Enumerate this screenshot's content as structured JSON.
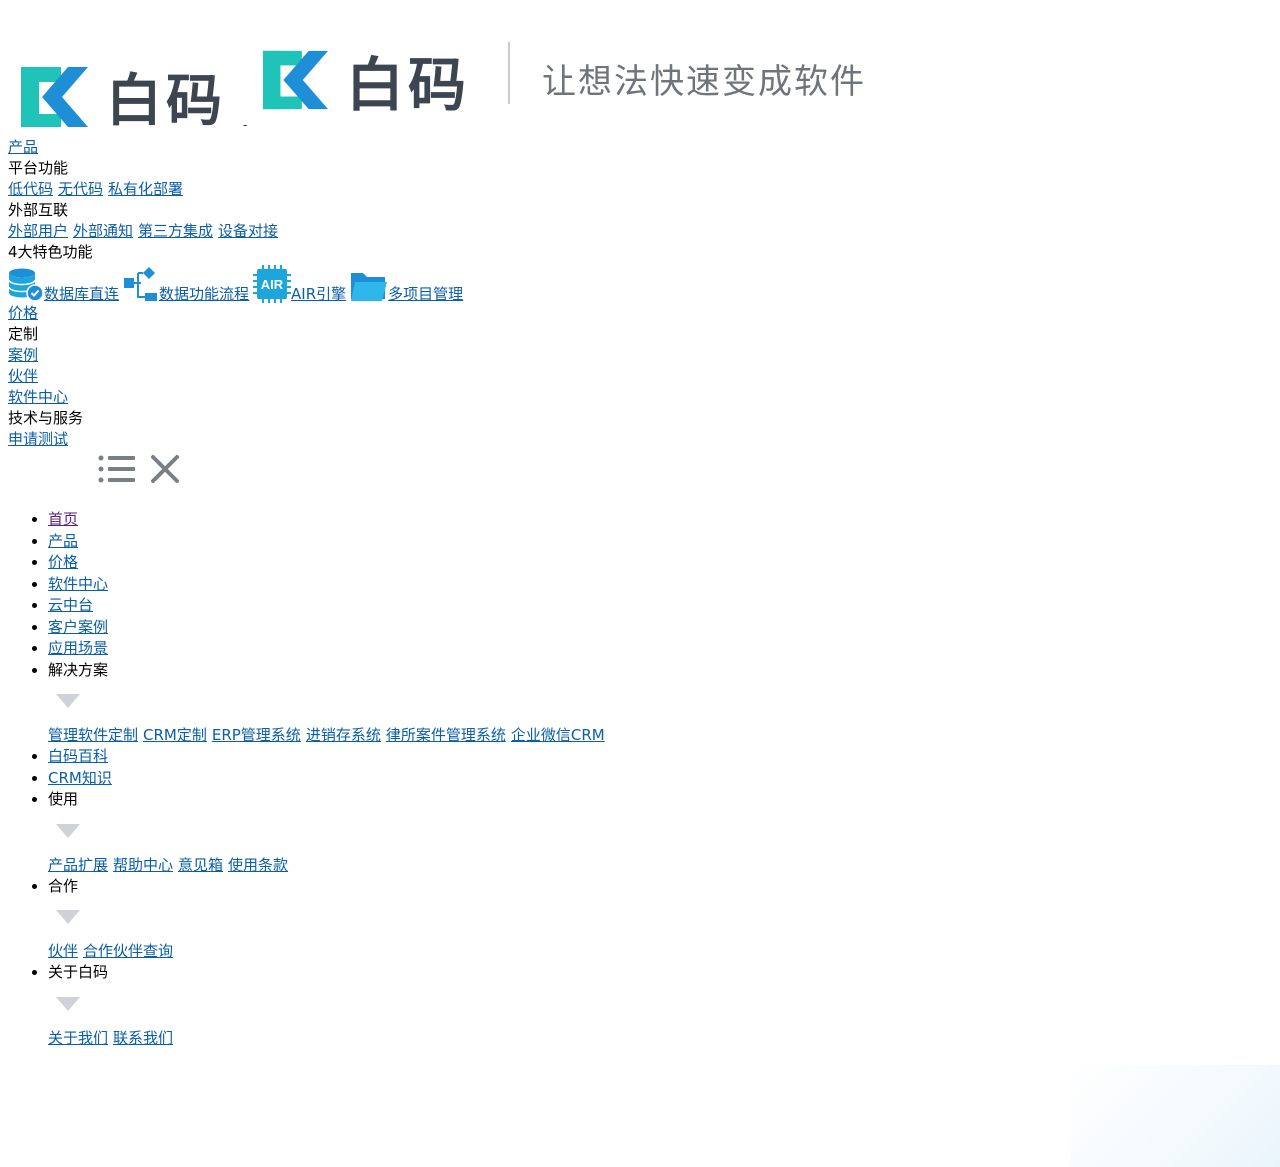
{
  "brand": {
    "logo_text": "白码",
    "slogan": "让想法快速变成软件",
    "colors": {
      "mark_blue": "#1e8fd6",
      "mark_teal": "#1fc3b7",
      "text_gray": "#3d4550",
      "link": "#0b5ea8",
      "visited": "#5a1f86"
    }
  },
  "top_nav": {
    "product_label": "产品",
    "platform_title": "平台功能",
    "platform_links": [
      "低代码",
      "无代码",
      "私有化部署"
    ],
    "external_title": "外部互联",
    "external_links": [
      "外部用户",
      "外部通知",
      "第三方集成",
      "设备对接"
    ],
    "features_title": "4大特色功能",
    "features": [
      {
        "label": "数据库直连",
        "icon": "database-icon"
      },
      {
        "label": "数据功能流程",
        "icon": "flow-icon"
      },
      {
        "label": "AIR引擎",
        "icon": "air-chip-icon",
        "badge": "AIR"
      },
      {
        "label": "多项目管理",
        "icon": "folder-icon"
      }
    ],
    "price": "价格",
    "custom_title": "定制",
    "cases": "案例",
    "partner": "伙伴",
    "software_center": "软件中心",
    "tech_title": "技术与服务",
    "apply_trial": "申请测试"
  },
  "toggle": {
    "menu_icon": "list-icon",
    "close_icon": "close-icon"
  },
  "main_menu": {
    "home": "首页",
    "product": "产品",
    "price": "价格",
    "software_center": "软件中心",
    "cloud": "云中台",
    "customer_cases": "客户案例",
    "scenarios": "应用场景",
    "solutions": {
      "title": "解决方案",
      "links": [
        "管理软件定制",
        "CRM定制",
        "ERP管理系统",
        "进销存系统",
        "律所案件管理系统",
        "企业微信CRM"
      ]
    },
    "wiki": "白码百科",
    "crm_knowledge": "CRM知识",
    "usage": {
      "title": "使用",
      "links": [
        "产品扩展",
        "帮助中心",
        "意见箱",
        "使用条款"
      ]
    },
    "cooperation": {
      "title": "合作",
      "links": [
        "伙伴",
        "合作伙伴查询"
      ]
    },
    "about": {
      "title": "关于白码",
      "links": [
        "关于我们",
        "联系我们"
      ]
    }
  }
}
